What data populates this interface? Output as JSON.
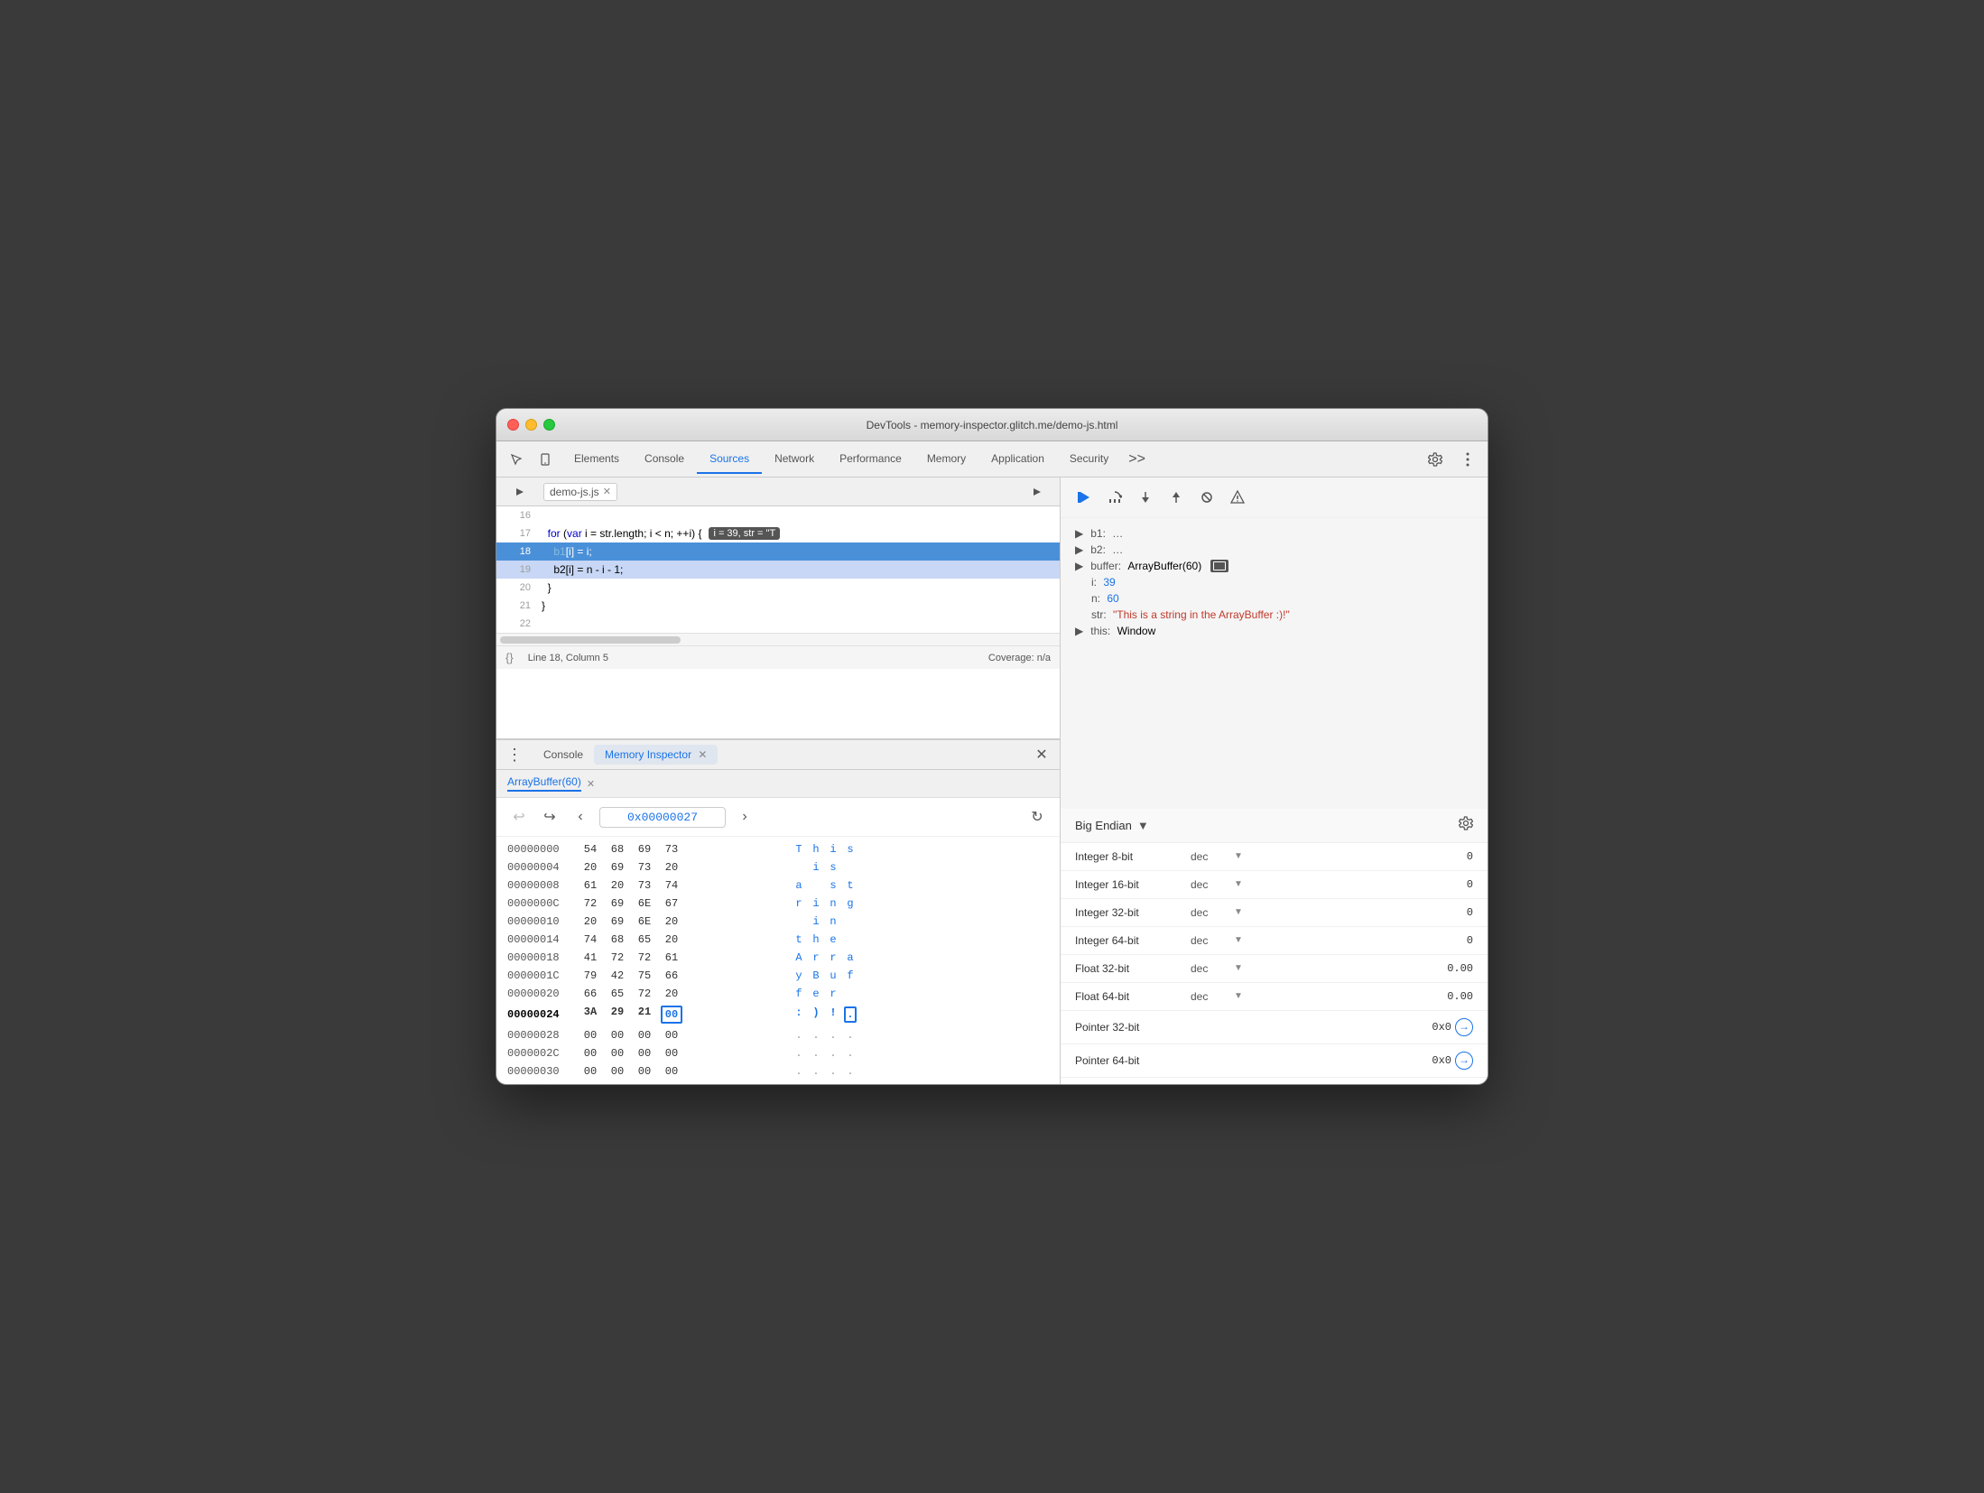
{
  "window": {
    "title": "DevTools - memory-inspector.glitch.me/demo-js.html"
  },
  "tabs": {
    "items": [
      "Elements",
      "Console",
      "Sources",
      "Network",
      "Performance",
      "Memory",
      "Application",
      "Security"
    ],
    "active": "Sources",
    "more": ">>"
  },
  "source": {
    "filename": "demo-js.js",
    "lines": [
      {
        "num": "16",
        "text": "",
        "content": ""
      },
      {
        "num": "17",
        "text": "  for (var i = str.length; i < n; ++i) {",
        "tooltip": " i = 39, str = \"T"
      },
      {
        "num": "18",
        "text": "    b1[i] = i;",
        "active": true
      },
      {
        "num": "19",
        "text": "    b2[i] = n - i - 1;"
      },
      {
        "num": "20",
        "text": "  }"
      },
      {
        "num": "21",
        "text": "}"
      },
      {
        "num": "22",
        "text": ""
      }
    ],
    "status": {
      "line_col": "Line 18, Column 5",
      "coverage": "Coverage: n/a"
    }
  },
  "bottom_tabs": {
    "items": [
      "Console",
      "Memory Inspector"
    ],
    "active": "Memory Inspector"
  },
  "memory_inspector": {
    "buffer_tab": "ArrayBuffer(60)",
    "address": "0x00000027",
    "rows": [
      {
        "addr": "00000000",
        "bytes": [
          "54",
          "68",
          "69",
          "73"
        ],
        "chars": [
          "T",
          "h",
          "i",
          "s"
        ],
        "bold": false
      },
      {
        "addr": "00000004",
        "bytes": [
          "20",
          "69",
          "73",
          "20"
        ],
        "chars": [
          " ",
          "i",
          "s",
          " "
        ],
        "bold": false
      },
      {
        "addr": "00000008",
        "bytes": [
          "61",
          "20",
          "73",
          "74"
        ],
        "chars": [
          "a",
          " ",
          "s",
          "t"
        ],
        "bold": false
      },
      {
        "addr": "0000000C",
        "bytes": [
          "72",
          "69",
          "6E",
          "67"
        ],
        "chars": [
          "r",
          "i",
          "n",
          "g"
        ],
        "bold": false
      },
      {
        "addr": "00000010",
        "bytes": [
          "20",
          "69",
          "6E",
          "20"
        ],
        "chars": [
          " ",
          "i",
          "n",
          " "
        ],
        "bold": false
      },
      {
        "addr": "00000014",
        "bytes": [
          "74",
          "68",
          "65",
          "20"
        ],
        "chars": [
          "t",
          "h",
          "e",
          " "
        ],
        "bold": false
      },
      {
        "addr": "00000018",
        "bytes": [
          "41",
          "72",
          "72",
          "61"
        ],
        "chars": [
          "A",
          "r",
          "r",
          "a"
        ],
        "bold": false
      },
      {
        "addr": "0000001C",
        "bytes": [
          "79",
          "42",
          "75",
          "66"
        ],
        "chars": [
          "y",
          "B",
          "u",
          "f"
        ],
        "bold": false
      },
      {
        "addr": "00000020",
        "bytes": [
          "66",
          "65",
          "72",
          "20"
        ],
        "chars": [
          "f",
          "e",
          "r",
          " "
        ],
        "bold": false
      },
      {
        "addr": "00000024",
        "bytes": [
          "3A",
          "29",
          "21",
          "00"
        ],
        "chars": [
          ":",
          ")",
          "!",
          "."
        ],
        "bold": true,
        "selected_byte": 3
      },
      {
        "addr": "00000028",
        "bytes": [
          "00",
          "00",
          "00",
          "00"
        ],
        "chars": [
          ".",
          ".",
          ".",
          "."
        ],
        "bold": false
      },
      {
        "addr": "0000002C",
        "bytes": [
          "00",
          "00",
          "00",
          "00"
        ],
        "chars": [
          ".",
          ".",
          ".",
          "."
        ],
        "bold": false
      },
      {
        "addr": "00000030",
        "bytes": [
          "00",
          "00",
          "00",
          "00"
        ],
        "chars": [
          ".",
          ".",
          ".",
          "."
        ],
        "bold": false
      }
    ]
  },
  "scope": {
    "items": [
      {
        "key": "b1:",
        "val": "…",
        "type": "ellipsis",
        "expanded": false
      },
      {
        "key": "b2:",
        "val": "…",
        "type": "ellipsis",
        "expanded": false
      },
      {
        "key": "buffer:",
        "val": "ArrayBuffer(60)",
        "type": "normal",
        "has_icon": true
      },
      {
        "key": "i:",
        "val": "39",
        "type": "num"
      },
      {
        "key": "n:",
        "val": "60",
        "type": "num"
      },
      {
        "key": "str:",
        "val": "\"This is a string in the ArrayBuffer :)!\"",
        "type": "str"
      },
      {
        "key": "this:",
        "val": "Window",
        "type": "normal"
      }
    ]
  },
  "value_inspector": {
    "endian": "Big Endian",
    "rows": [
      {
        "label": "Integer 8-bit",
        "format": "dec",
        "value": "0"
      },
      {
        "label": "Integer 16-bit",
        "format": "dec",
        "value": "0"
      },
      {
        "label": "Integer 32-bit",
        "format": "dec",
        "value": "0"
      },
      {
        "label": "Integer 64-bit",
        "format": "dec",
        "value": "0"
      },
      {
        "label": "Float 32-bit",
        "format": "dec",
        "value": "0.00"
      },
      {
        "label": "Float 64-bit",
        "format": "dec",
        "value": "0.00"
      }
    ],
    "pointers": [
      {
        "label": "Pointer 32-bit",
        "value": "0x0"
      },
      {
        "label": "Pointer 64-bit",
        "value": "0x0"
      }
    ]
  },
  "debug_controls": {
    "buttons": [
      "play-pause",
      "step-over",
      "step-into",
      "step-out",
      "deactivate",
      "pause-on-exception"
    ]
  }
}
